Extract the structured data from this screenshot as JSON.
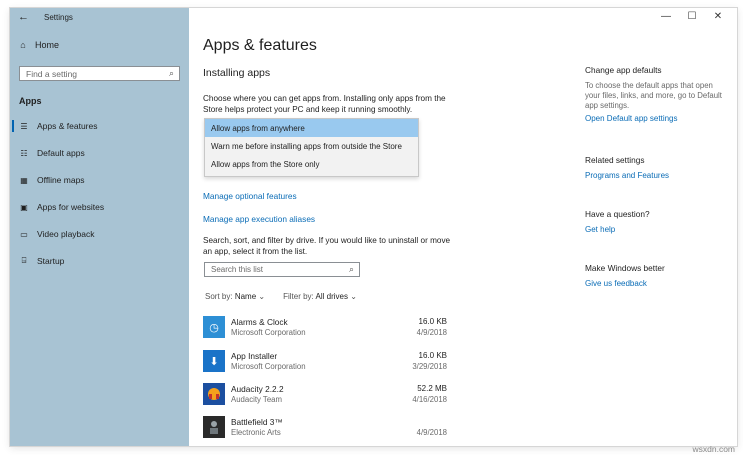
{
  "window": {
    "title": "Settings",
    "controls": [
      "—",
      "☐",
      "✕"
    ]
  },
  "sidebar": {
    "home_label": "Home",
    "search_placeholder": "Find a setting",
    "section_label": "Apps",
    "items": [
      {
        "label": "Apps & features",
        "icon": "list-icon",
        "selected": true
      },
      {
        "label": "Default apps",
        "icon": "default-apps-icon",
        "selected": false
      },
      {
        "label": "Offline maps",
        "icon": "map-icon",
        "selected": false
      },
      {
        "label": "Apps for websites",
        "icon": "website-icon",
        "selected": false
      },
      {
        "label": "Video playback",
        "icon": "video-icon",
        "selected": false
      },
      {
        "label": "Startup",
        "icon": "startup-icon",
        "selected": false
      }
    ]
  },
  "main": {
    "title": "Apps & features",
    "installing_title": "Installing apps",
    "installing_desc": "Choose where you can get apps from. Installing only apps from the Store helps protect your PC and keep it running smoothly.",
    "dropdown_options": [
      "Allow apps from anywhere",
      "Warn me before installing apps from outside the Store",
      "Allow apps from the Store only"
    ],
    "link_optional": "Manage optional features",
    "link_aliases": "Manage app execution aliases",
    "search_desc": "Search, sort, and filter by drive. If you would like to uninstall or move an app, select it from the list.",
    "search_placeholder": "Search this list",
    "sort_label": "Sort by:",
    "sort_value": "Name",
    "filter_label": "Filter by:",
    "filter_value": "All drives",
    "apps": [
      {
        "name": "Alarms & Clock",
        "publisher": "Microsoft Corporation",
        "size": "16.0 KB",
        "date": "4/9/2018",
        "color": "#2d8fd5"
      },
      {
        "name": "App Installer",
        "publisher": "Microsoft Corporation",
        "size": "16.0 KB",
        "date": "3/29/2018",
        "color": "#1a73c8"
      },
      {
        "name": "Audacity 2.2.2",
        "publisher": "Audacity Team",
        "size": "52.2 MB",
        "date": "4/16/2018",
        "color": "#1c4fa0"
      },
      {
        "name": "Battlefield 3™",
        "publisher": "Electronic Arts",
        "size": "",
        "date": "4/9/2018",
        "color": "#2a2a2a"
      }
    ]
  },
  "right": {
    "defaults_head": "Change app defaults",
    "defaults_text": "To choose the default apps that open your files, links, and more, go to Default app settings.",
    "defaults_link": "Open Default app settings",
    "related_head": "Related settings",
    "related_link": "Programs and Features",
    "question_head": "Have a question?",
    "question_link": "Get help",
    "better_head": "Make Windows better",
    "better_link": "Give us feedback"
  },
  "watermark": "wsxdn.com"
}
